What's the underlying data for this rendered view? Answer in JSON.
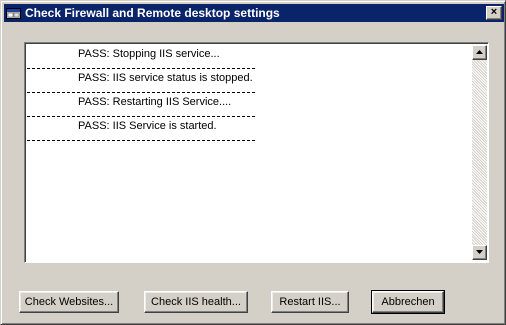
{
  "window": {
    "title": "Check Firewall and Remote desktop settings",
    "close_label": "×"
  },
  "log": {
    "lines": [
      "PASS: Stopping IIS service...",
      "PASS: IIS service status is stopped.",
      "PASS: Restarting IIS Service....",
      "PASS: IIS Service is started."
    ]
  },
  "buttons": {
    "check_websites": "Check Websites...",
    "check_iis_health": "Check IIS health...",
    "restart_iis": "Restart IIS...",
    "cancel": "Abbrechen"
  },
  "colors": {
    "titlebar": "#0a246a",
    "face": "#d4d0c8"
  },
  "icons": {
    "window": "app-window-icon",
    "close": "close-icon",
    "scroll_up": "arrow-up-icon",
    "scroll_down": "arrow-down-icon"
  }
}
